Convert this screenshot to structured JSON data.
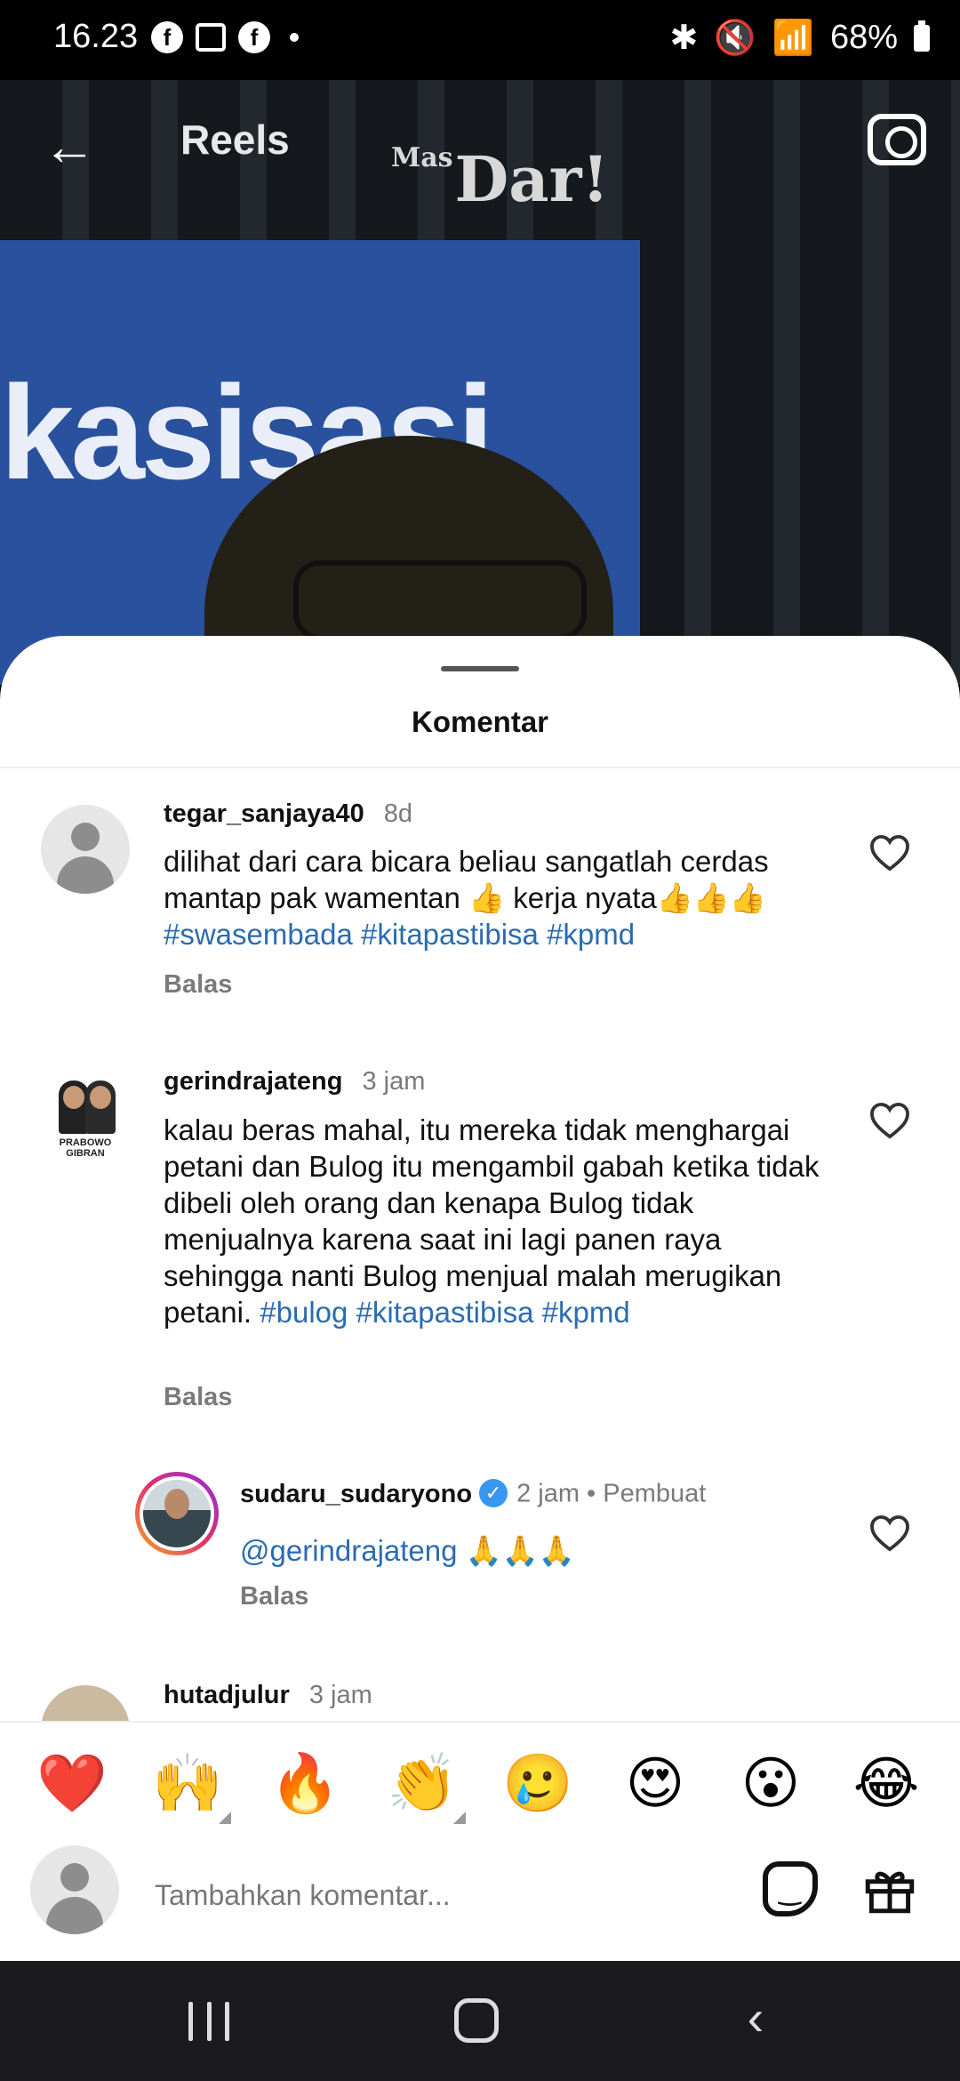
{
  "status_bar": {
    "time": "16.23",
    "battery": "68%"
  },
  "header": {
    "title": "Reels",
    "video_logo_small": "Mas",
    "video_logo": "Dar!",
    "video_panel_text": "kasisasi"
  },
  "sheet": {
    "title": "Komentar"
  },
  "comments": [
    {
      "username": "tegar_sanjaya40",
      "time": "8d",
      "text_lines": [
        "dilihat dari cara bicara beliau sangatlah cerdas",
        "mantap pak wamentan 👍 kerja nyata👍👍👍"
      ],
      "hashtags": "#swasembada  #kitapastibisa #kpmd",
      "reply_label": "Balas"
    },
    {
      "username": "gerindrajateng",
      "time": "3 jam",
      "avatar_label": "PRABOWO GIBRAN",
      "text": "kalau beras mahal, itu mereka tidak menghargai petani dan Bulog itu mengambil gabah ketika tidak dibeli oleh orang dan kenapa Bulog tidak menjualnya karena saat ini lagi panen raya sehingga nanti Bulog menjual malah merugikan petani.",
      "hashtags": "#bulog #kitapastibisa #kpmd",
      "reply_label": "Balas"
    },
    {
      "username": "sudaru_sudaryono",
      "time": "2 jam",
      "creator_label": "Pembuat",
      "mention": "@gerindrajateng",
      "text": "🙏🙏🙏",
      "reply_label": "Balas"
    },
    {
      "username": "hutadjulur",
      "time": "3 jam"
    }
  ],
  "emoji_bar": [
    "❤️",
    "🙌",
    "🔥",
    "👏",
    "🥲",
    "😍",
    "😮",
    "😂"
  ],
  "input": {
    "placeholder": "Tambahkan komentar..."
  },
  "icons": {
    "back": "arrow-left-icon",
    "camera": "camera-icon",
    "heart": "heart-outline-icon",
    "sticker": "sticker-icon",
    "gift": "gift-icon"
  },
  "colors": {
    "hashtag": "#2a6cb0",
    "verified": "#3897f0"
  }
}
